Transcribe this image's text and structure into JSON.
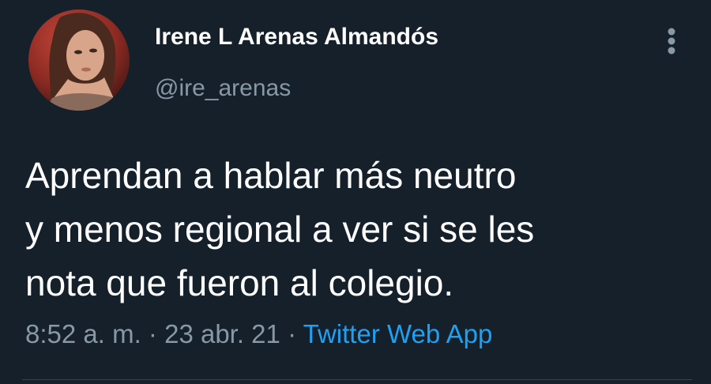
{
  "tweet": {
    "author": {
      "display_name": "Irene L Arenas Almandós",
      "handle": "@ire_arenas",
      "avatar_icon": "profile-photo"
    },
    "text_lines": [
      "Aprendan a hablar más neutro",
      "y menos regional a ver si se les",
      "nota que fueron al colegio."
    ],
    "time": "8:52 a. m.",
    "separator": "·",
    "date": "23 abr. 21",
    "source": "Twitter Web App",
    "more_icon": "more-vertical-icon"
  },
  "colors": {
    "background": "#15202b",
    "text_primary": "#ffffff",
    "text_secondary": "#8899a6",
    "link": "#1da1f2",
    "divider": "#38444d"
  }
}
